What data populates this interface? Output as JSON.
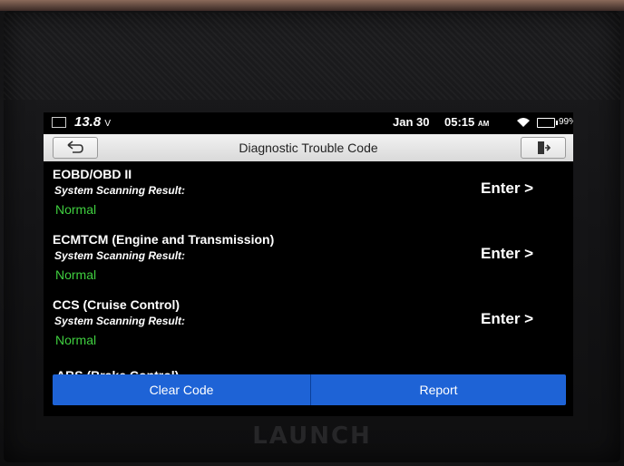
{
  "status_bar": {
    "voltage": "13.8",
    "voltage_unit": "V",
    "date": "Jan 30",
    "time": "05:15",
    "am_pm": "AM",
    "battery": "99%"
  },
  "header": {
    "title": "Diagnostic Trouble Code",
    "back_icon": "back-arrow-icon",
    "exit_icon": "exit-door-icon"
  },
  "systems": [
    {
      "name": "EOBD/OBD II",
      "label": "System Scanning Result:",
      "result": "Normal",
      "action": "Enter >"
    },
    {
      "name": "ECMTCM (Engine and Transmission)",
      "label": "System Scanning Result:",
      "result": "Normal",
      "action": "Enter >"
    },
    {
      "name": "CCS (Cruise Control)",
      "label": "System Scanning Result:",
      "result": "Normal",
      "action": "Enter >"
    }
  ],
  "partial_item": "ABS (Brake Control)",
  "buttons": {
    "clear": "Clear Code",
    "report": "Report"
  },
  "brand": "LAUNCH",
  "colors": {
    "accent_blue": "#1e63d6",
    "normal_green": "#3fcf3f"
  }
}
